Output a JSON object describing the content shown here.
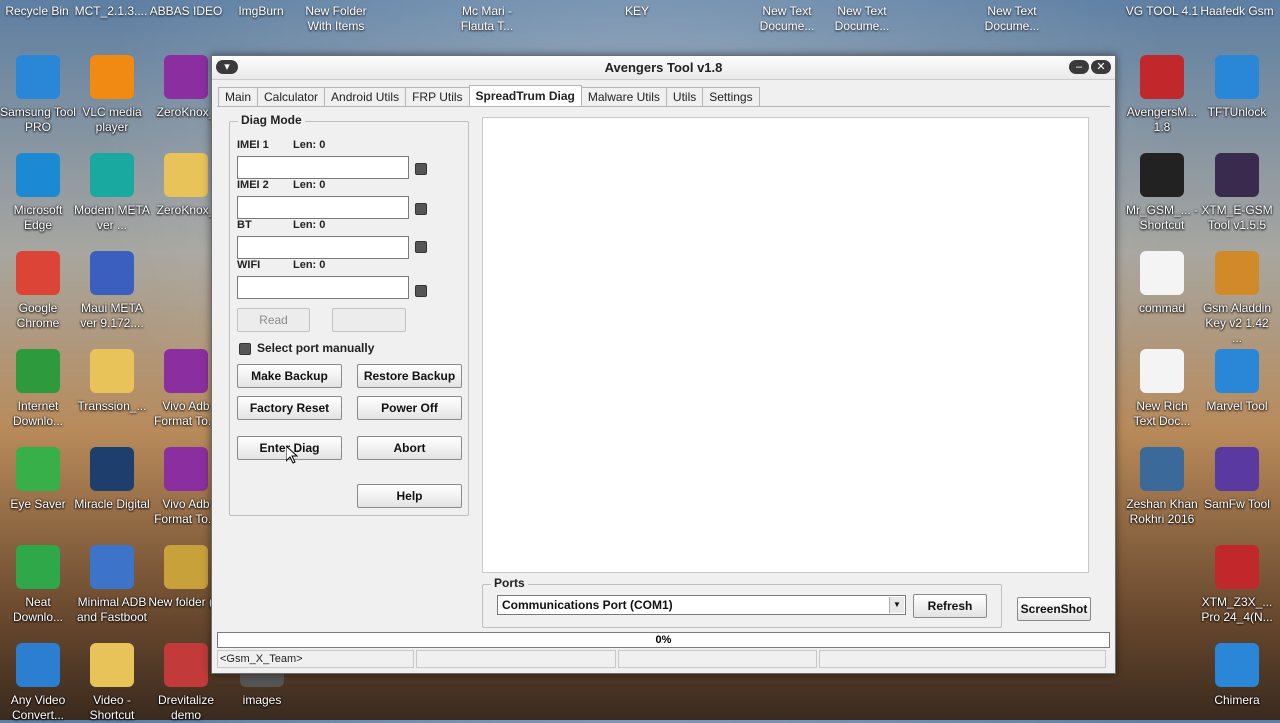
{
  "desktop": {
    "top_labels": [
      "Recycle Bin",
      "MCT_2.1.3....",
      "ABBAS IDEO",
      "ImgBurn",
      "New Folder With Items",
      "Mc Mari - Flauta T...",
      "KEY",
      "New Text Docume...",
      "New Text Docume...",
      "New Text Docume...",
      "VG TOOL 4.1",
      "Haafedk Gsm"
    ],
    "left_icons": [
      {
        "label": "Samsung Tool PRO",
        "icon": "gear-icon",
        "color": "#2a86d6"
      },
      {
        "label": "VLC media player",
        "icon": "cone-icon",
        "color": "#f08a12"
      },
      {
        "label": "ZeroKnox_",
        "icon": "archive-icon",
        "color": "#8b2fa0"
      },
      {
        "label": "Microsoft Edge",
        "icon": "edge-icon",
        "color": "#1c8ad3"
      },
      {
        "label": "Modem META ver ...",
        "icon": "k-logo-icon",
        "color": "#19a9a0"
      },
      {
        "label": "ZeroKnox_",
        "icon": "folder-icon",
        "color": "#e8c35a"
      },
      {
        "label": "Google Chrome",
        "icon": "chrome-icon",
        "color": "#db4437"
      },
      {
        "label": "Maui META ver 9.172....",
        "icon": "building-icon",
        "color": "#3b5fbf"
      },
      {
        "label": "Internet Downlo...",
        "icon": "globe-icon",
        "color": "#2d9a3e"
      },
      {
        "label": "Transsion_...",
        "icon": "folder-icon",
        "color": "#e8c35a"
      },
      {
        "label": "Vivo Adb Format To...",
        "icon": "archive-icon",
        "color": "#8b2fa0"
      },
      {
        "label": "Eye Saver",
        "icon": "plus-shield-icon",
        "color": "#38b04a"
      },
      {
        "label": "Miracle Digital",
        "icon": "miracle-icon",
        "color": "#1e3e6e"
      },
      {
        "label": "Vivo Adb Format To...",
        "icon": "archive-icon",
        "color": "#8b2fa0"
      },
      {
        "label": "Neat Downlo...",
        "icon": "n-logo-icon",
        "color": "#2fa84a"
      },
      {
        "label": "Minimal ADB and Fastboot",
        "icon": "window-icon",
        "color": "#3d74c9"
      },
      {
        "label": "New folder (3)",
        "icon": "folder-icon",
        "color": "#c9a13a"
      },
      {
        "label": "Any Video Convert...",
        "icon": "video-icon",
        "color": "#2c7fd0"
      },
      {
        "label": "Video - Shortcut",
        "icon": "folder-icon",
        "color": "#e8c35a"
      },
      {
        "label": "Drevitalize demo",
        "icon": "disk-icon",
        "color": "#c23a3a"
      },
      {
        "label": "images",
        "icon": "image-icon",
        "color": "#555555"
      }
    ],
    "right_icons": [
      {
        "label": "AvengersM... 1.8",
        "icon": "gear-red-icon",
        "color": "#c0282b"
      },
      {
        "label": "TFTUnlock",
        "icon": "shield-icon",
        "color": "#2a86d6"
      },
      {
        "label": "Mr_GSM_... - Shortcut",
        "icon": "mtk-icon",
        "color": "#222222"
      },
      {
        "label": "XTM_E-GSM Tool v1.5.5",
        "icon": "xtm-icon",
        "color": "#3a2a4e"
      },
      {
        "label": "commad",
        "icon": "document-icon",
        "color": "#f4f4f4"
      },
      {
        "label": "Gsm Aladdin Key v2 1.42 ...",
        "icon": "aladdin-icon",
        "color": "#d08a2a"
      },
      {
        "label": "New Rich Text Doc...",
        "icon": "rich-doc-icon",
        "color": "#f4f4f4"
      },
      {
        "label": "Marvel Tool",
        "icon": "marvel-icon",
        "color": "#2a86d6"
      },
      {
        "label": "Zeshan Khan Rokhri 2016",
        "icon": "photo-icon",
        "color": "#3b6a9a"
      },
      {
        "label": "SamFw Tool",
        "icon": "samfw-icon",
        "color": "#5a3aa0"
      },
      {
        "label": "XTM_Z3X_... Pro 24_4(N...",
        "icon": "gear-red-icon",
        "color": "#c0282b"
      },
      {
        "label": "Chimera",
        "icon": "chimera-icon",
        "color": "#2a86d6"
      }
    ]
  },
  "window": {
    "title": "Avengers Tool v1.8",
    "tabs": [
      "Main",
      "Calculator",
      "Android Utils",
      "FRP Utils",
      "SpreadTrum Diag",
      "Malware Utils",
      "Utils",
      "Settings"
    ],
    "active_tab": "SpreadTrum Diag",
    "diag": {
      "group_title": "Diag Mode",
      "fields": [
        {
          "label": "IMEI 1",
          "len": "Len: 0",
          "value": ""
        },
        {
          "label": "IMEI 2",
          "len": "Len: 0",
          "value": ""
        },
        {
          "label": "BT",
          "len": "Len: 0",
          "value": ""
        },
        {
          "label": "WIFI",
          "len": "Len: 0",
          "value": ""
        }
      ],
      "read_button": "Read",
      "write_button": "",
      "select_port_label": "Select port manually",
      "buttons": {
        "make_backup": "Make Backup",
        "restore_backup": "Restore Backup",
        "factory_reset": "Factory Reset",
        "power_off": "Power Off",
        "enter_diag": "Enter Diag",
        "abort": "Abort",
        "help": "Help"
      }
    },
    "ports": {
      "group_title": "Ports",
      "selected": "Communications Port (COM1)",
      "refresh": "Refresh"
    },
    "screenshot_button": "ScreenShot",
    "progress": {
      "value": 0,
      "text": "0%"
    },
    "status": [
      "<Gsm_X_Team>",
      "",
      "",
      ""
    ]
  }
}
